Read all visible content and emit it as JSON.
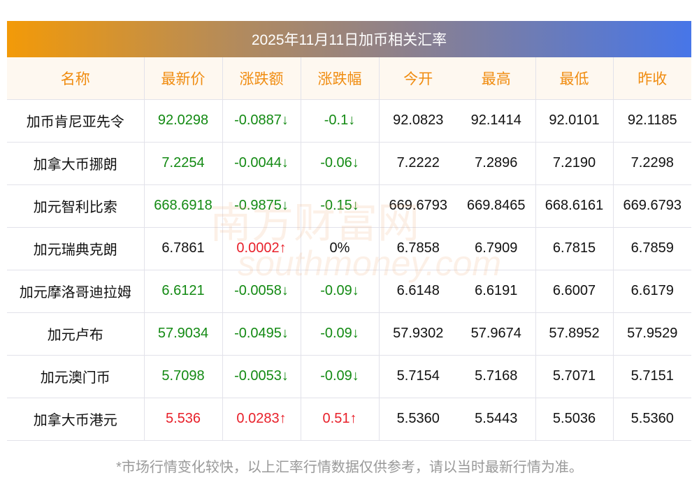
{
  "title": "2025年11月11日加币相关汇率",
  "headers": [
    "名称",
    "最新价",
    "涨跌额",
    "涨跌幅",
    "今开",
    "最高",
    "最低",
    "昨收"
  ],
  "rows": [
    {
      "name": "加币肯尼亚先令",
      "latest": "92.0298",
      "change": "-0.0887↓",
      "pct": "-0.1↓",
      "open": "92.0823",
      "high": "92.1414",
      "low": "92.0101",
      "prev": "92.1185",
      "dir": "down"
    },
    {
      "name": "加拿大币挪朗",
      "latest": "7.2254",
      "change": "-0.0044↓",
      "pct": "-0.06↓",
      "open": "7.2222",
      "high": "7.2896",
      "low": "7.2190",
      "prev": "7.2298",
      "dir": "down"
    },
    {
      "name": "加元智利比索",
      "latest": "668.6918",
      "change": "-0.9875↓",
      "pct": "-0.15↓",
      "open": "669.6793",
      "high": "669.8465",
      "low": "668.6161",
      "prev": "669.6793",
      "dir": "down"
    },
    {
      "name": "加元瑞典克朗",
      "latest": "6.7861",
      "change": "0.0002↑",
      "pct": "0%",
      "open": "6.7858",
      "high": "6.7909",
      "low": "6.7815",
      "prev": "6.7859",
      "dir": "flat"
    },
    {
      "name": "加元摩洛哥迪拉姆",
      "latest": "6.6121",
      "change": "-0.0058↓",
      "pct": "-0.09↓",
      "open": "6.6148",
      "high": "6.6191",
      "low": "6.6007",
      "prev": "6.6179",
      "dir": "down"
    },
    {
      "name": "加元卢布",
      "latest": "57.9034",
      "change": "-0.0495↓",
      "pct": "-0.09↓",
      "open": "57.9302",
      "high": "57.9674",
      "low": "57.8952",
      "prev": "57.9529",
      "dir": "down"
    },
    {
      "name": "加元澳门币",
      "latest": "5.7098",
      "change": "-0.0053↓",
      "pct": "-0.09↓",
      "open": "5.7154",
      "high": "5.7168",
      "low": "5.7071",
      "prev": "5.7151",
      "dir": "down"
    },
    {
      "name": "加拿大币港元",
      "latest": "5.536",
      "change": "0.0283↑",
      "pct": "0.51↑",
      "open": "5.5360",
      "high": "5.5443",
      "low": "5.5036",
      "prev": "5.5360",
      "dir": "up"
    }
  ],
  "watermark": {
    "cn": "南方财富网",
    "en": "southmoney.com"
  },
  "note": "*市场行情变化较快，以上汇率行情数据仅供参考，请以当时最新行情为准。",
  "colors": {
    "up": "#e8202a",
    "down": "#138a13",
    "header": "#f08c10"
  }
}
